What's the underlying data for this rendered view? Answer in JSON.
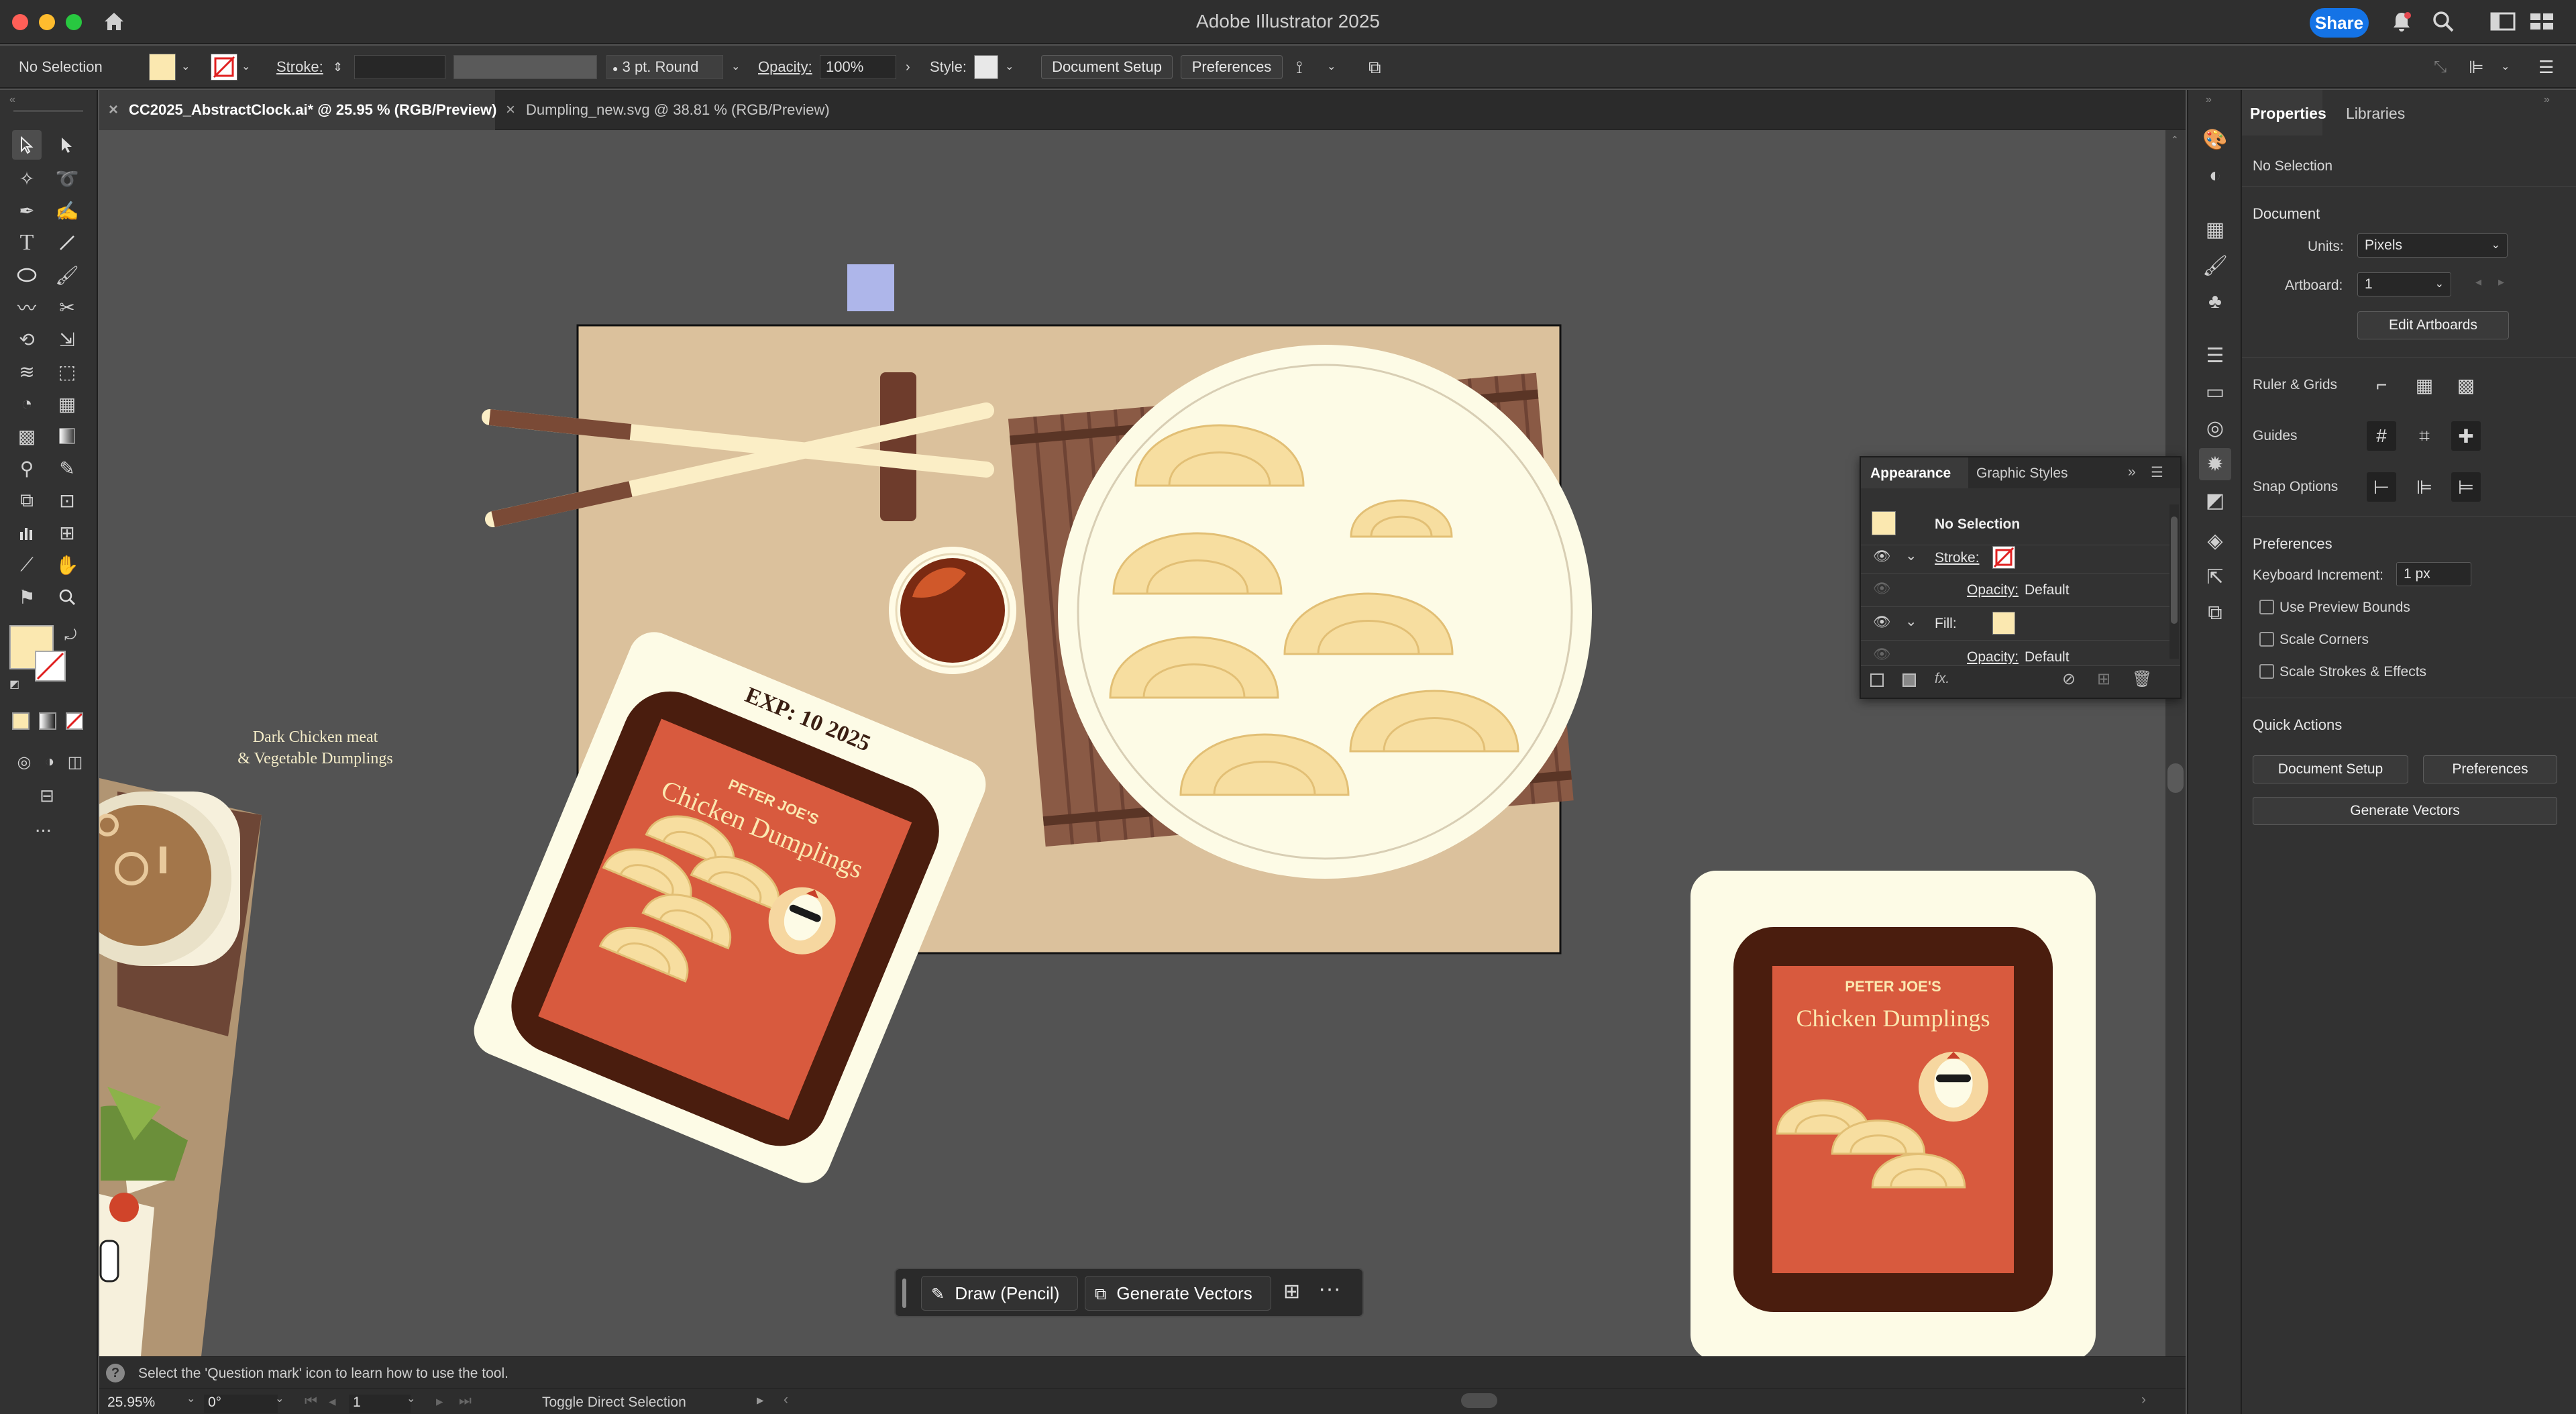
{
  "app": {
    "title": "Adobe Illustrator 2025",
    "share_label": "Share",
    "colors": {
      "accent": "#1473e6",
      "fill_swatch": "#fbe8b0"
    }
  },
  "control_bar": {
    "selection": "No Selection",
    "stroke_label": "Stroke:",
    "brush_label": "3 pt. Round",
    "opacity_label": "Opacity:",
    "opacity_value": "100%",
    "style_label": "Style:",
    "document_setup": "Document Setup",
    "preferences": "Preferences"
  },
  "tabs": [
    {
      "label": "CC2025_AbstractClock.ai* @ 25.95 % (RGB/Preview)"
    },
    {
      "label": "Dumpling_new.svg @ 38.81 % (RGB/Preview)"
    }
  ],
  "toolbar": {
    "more": "..."
  },
  "artwork": {
    "caption_line1": "Dark Chicken meat",
    "caption_line2": "& Vegetable Dumplings",
    "exp": "EXP: 10 2025",
    "brand": "PETER JOE'S",
    "product": "Chicken Dumplings"
  },
  "context_bar": {
    "draw_label": "Draw (Pencil)",
    "generate_label": "Generate Vectors"
  },
  "appearance": {
    "tab_appearance": "Appearance",
    "tab_graphic_styles": "Graphic Styles",
    "selection": "No Selection",
    "stroke_label": "Stroke:",
    "stroke_opacity": "Opacity:",
    "stroke_opacity_value": "Default",
    "fill_label": "Fill:",
    "fill_opacity": "Opacity:",
    "fill_opacity_value": "Default",
    "fx_label": "fx."
  },
  "properties": {
    "tab_properties": "Properties",
    "tab_libraries": "Libraries",
    "selection": "No Selection",
    "document_heading": "Document",
    "units_label": "Units:",
    "units_value": "Pixels",
    "artboard_label": "Artboard:",
    "artboard_value": "1",
    "edit_artboards": "Edit Artboards",
    "ruler_grids": "Ruler & Grids",
    "guides": "Guides",
    "snap_options": "Snap Options",
    "preferences_heading": "Preferences",
    "keyboard_increment_label": "Keyboard Increment:",
    "keyboard_increment_value": "1 px",
    "use_preview_bounds": "Use Preview Bounds",
    "scale_corners": "Scale Corners",
    "scale_strokes": "Scale Strokes & Effects",
    "quick_actions": "Quick Actions",
    "document_setup_btn": "Document Setup",
    "preferences_btn": "Preferences",
    "generate_vectors_btn": "Generate Vectors"
  },
  "status": {
    "hint": "Select the 'Question mark' icon to learn how to use the tool.",
    "zoom": "25.95%",
    "rotation": "0°",
    "artboard": "1",
    "tool": "Toggle Direct Selection"
  }
}
